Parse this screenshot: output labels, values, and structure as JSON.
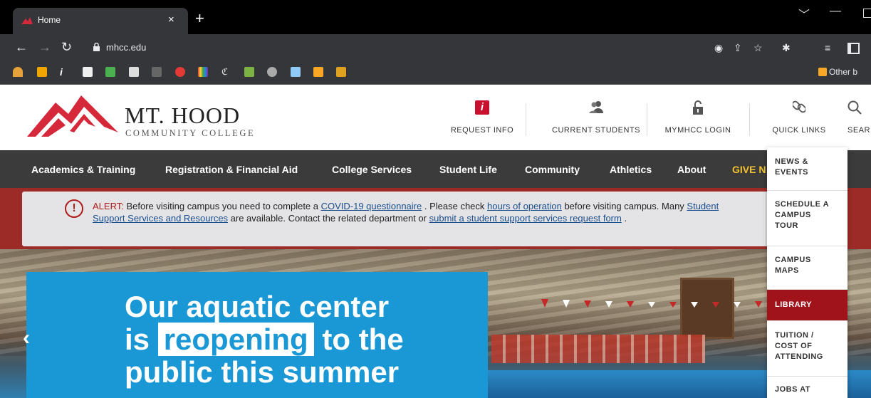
{
  "browser": {
    "tab_title": "Home",
    "tab_close": "×",
    "new_tab": "+",
    "url": "mhcc.edu",
    "other_bookmarks": "Other b",
    "win_min": "—",
    "win_chevron": "﹀"
  },
  "site": {
    "logo_line1": "MT. HOOD",
    "logo_line2": "COMMUNITY COLLEGE",
    "utility": [
      {
        "label": "REQUEST INFO",
        "icon": "info-icon"
      },
      {
        "label": "CURRENT STUDENTS",
        "icon": "people-icon"
      },
      {
        "label": "MYMHCC LOGIN",
        "icon": "unlock-icon"
      },
      {
        "label": "QUICK LINKS",
        "icon": "link-icon"
      },
      {
        "label": "SEAR",
        "icon": "search-icon"
      }
    ],
    "nav": [
      "Academics & Training",
      "Registration & Financial Aid",
      "College Services",
      "Student Life",
      "Community",
      "Athletics",
      "About",
      "GIVE N"
    ]
  },
  "alert": {
    "prefix": "ALERT:",
    "t1": " Before visiting campus you need to complete a ",
    "link1": "COVID-19 questionnaire",
    "t2": " . Please check ",
    "link2": "hours of operation",
    "t3": " before visiting campus. Many ",
    "link3": "Student Support Services and Resources",
    "t4": " are available. Contact the related department or ",
    "link4": "submit a student support services request form",
    "t5": " ."
  },
  "hero": {
    "line1": "Our aquatic center",
    "line2_pre": "is ",
    "line2_highlight": "reopening",
    "line2_post": " to the",
    "line3": "public this summer",
    "prev": "‹"
  },
  "quick_links": [
    {
      "label": "NEWS &\nEVENTS"
    },
    {
      "label": "SCHEDULE A\nCAMPUS\nTOUR"
    },
    {
      "label": "CAMPUS\nMAPS"
    },
    {
      "label": "LIBRARY"
    },
    {
      "label": "TUITION /\nCOST OF\nATTENDING"
    },
    {
      "label": "JOBS AT"
    }
  ]
}
